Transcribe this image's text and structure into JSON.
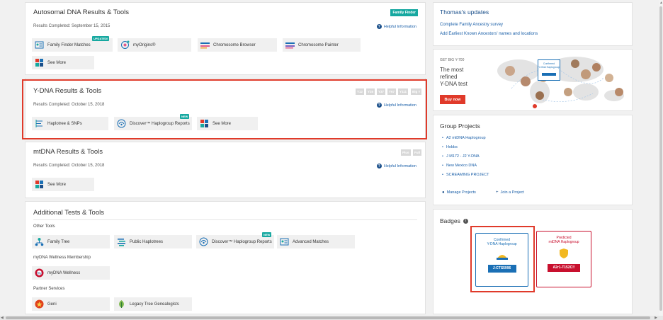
{
  "autosomal": {
    "title": "Autosomal DNA Results & Tools",
    "tag": "Family Finder",
    "completed": "Results Completed: September 15, 2015",
    "help": "Helpful Information",
    "tools": [
      {
        "label": "Family Finder Matches",
        "badge": "UPDATED!"
      },
      {
        "label": "myOrigins®",
        "badge": ""
      },
      {
        "label": "Chromosome Browser",
        "badge": ""
      },
      {
        "label": "Chromosome Painter",
        "badge": ""
      },
      {
        "label": "See More",
        "badge": ""
      }
    ]
  },
  "ydna": {
    "title": "Y-DNA Results & Tools",
    "tags": [
      "Y12",
      "Y25",
      "Y37",
      "Y67",
      "Y111",
      "Big Y"
    ],
    "completed": "Results Completed: October 15, 2018",
    "help": "Helpful Information",
    "tools": [
      {
        "label": "Haplotree & SNPs",
        "badge": ""
      },
      {
        "label": "Discover™ Haplogroup Reports",
        "badge": "NEW"
      },
      {
        "label": "See More",
        "badge": ""
      }
    ]
  },
  "mtdna": {
    "title": "mtDNA Results & Tools",
    "tags": [
      "Plus",
      "Full"
    ],
    "completed": "Results Completed: October 15, 2018",
    "help": "Helpful Information",
    "tools": [
      {
        "label": "See More",
        "badge": ""
      }
    ]
  },
  "additional": {
    "title": "Additional Tests & Tools",
    "other_label": "Other Tools",
    "other_tools": [
      {
        "label": "Family Tree",
        "badge": ""
      },
      {
        "label": "Public Haplotrees",
        "badge": ""
      },
      {
        "label": "Discover™ Haplogroup Reports",
        "badge": "NEW"
      },
      {
        "label": "Advanced Matches",
        "badge": ""
      }
    ],
    "wellness_label": "myDNA Wellness Membership",
    "wellness_tool": "myDNA Wellness",
    "partner_label": "Partner Services",
    "partner_tools": [
      {
        "label": "Geni"
      },
      {
        "label": "Legacy Tree Genealogists"
      }
    ]
  },
  "updates": {
    "title": "Thomas's updates",
    "links": [
      "Complete Family Ancestry survey",
      "Add Earliest Known Ancestors' names and locations"
    ]
  },
  "promo": {
    "small": "GET BIG Y-700",
    "headline": [
      "The most",
      "refined",
      "Y-DNA test"
    ],
    "button": "Buy now",
    "card_title": [
      "Confirmed",
      "Y-DNA Haplogroup"
    ]
  },
  "groups": {
    "title": "Group Projects",
    "items": [
      "A2 mtDNA Haplogroup",
      "Hobbs",
      "J M172 - J2 Y-DNA",
      "New Mexico DNA",
      "SCREAMING PROJECT"
    ],
    "manage": "Manage Projects",
    "join": "Join a Project"
  },
  "badges": {
    "title": "Badges",
    "confirmed": {
      "line1": "Confirmed",
      "line2": "Y-DNA Haplogroup",
      "value": "J-CTS5996",
      "color": "#1a6fb5"
    },
    "predicted": {
      "line1": "Predicted",
      "line2": "mtDNA Haplogroup",
      "value": "A2r1-T152C!!",
      "color": "#c8102e"
    }
  },
  "colors": {
    "accent": "#16a8a0",
    "link": "#1a5fa8",
    "highlight": "#e03a2a"
  }
}
